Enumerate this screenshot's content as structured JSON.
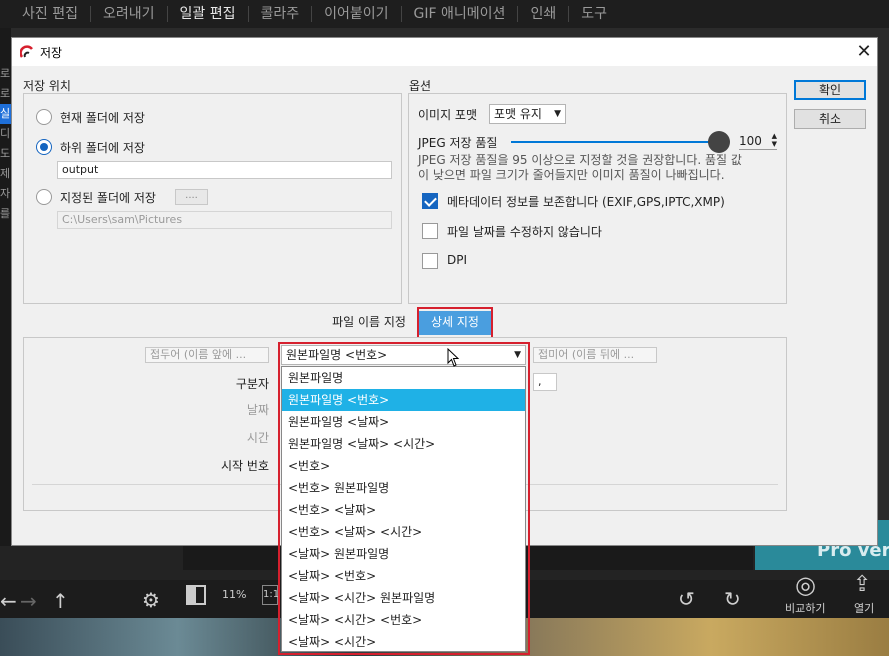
{
  "app": {
    "nav": [
      "사진 편집",
      "오려내기",
      "일괄 편집",
      "콜라주",
      "이어붙이기",
      "GIF 애니메이션",
      "인쇄",
      "도구"
    ],
    "active_nav": "일괄 편집",
    "left_items": [
      "로",
      "로",
      "실",
      "디",
      "도",
      "제",
      "자",
      "를"
    ],
    "pro_banner": "Pro vers",
    "zoom": "11%",
    "zoom_ratio": "1:1",
    "compare_label": "비교하기",
    "open_label": "열기"
  },
  "dialog": {
    "title": "저장",
    "close": "✕",
    "location": {
      "label": "저장 위치",
      "current_folder": "현재 폴더에 저장",
      "sub_folder": "하위 폴더에 저장",
      "sub_folder_value": "output",
      "specified_folder": "지정된 폴더에 저장",
      "browse": "....",
      "path_value": "C:\\Users\\sam\\Pictures",
      "selected": "sub_folder"
    },
    "options": {
      "label": "옵션",
      "format_label": "이미지 포맷",
      "format_value": "포맷 유지",
      "jpeg_label": "JPEG 저장 품질",
      "jpeg_value": "100",
      "jpeg_quality": 100,
      "jpeg_note_1": "JPEG 저장 품질을 95 이상으로 지정할 것을 권장합니다. 품질 값",
      "jpeg_note_2": "이 낮으면 파일 크기가 줄어들지만 이미지 품질이 나빠집니다.",
      "metadata_label": "메타데이터 정보를 보존합니다 (EXIF,GPS,IPTC,XMP)",
      "metadata_checked": true,
      "filedate_label": "파일 날짜를 수정하지 않습니다",
      "filedate_checked": false,
      "dpi_label": "DPI",
      "dpi_checked": false
    },
    "buttons": {
      "ok": "확인",
      "cancel": "취소"
    },
    "tabs": {
      "filename": "파일 이름 지정",
      "advanced": "상세 지정"
    },
    "naming": {
      "prefix_placeholder": "접두어 (이름 앞에 ...",
      "pattern_value": "원본파일명 <번호>",
      "suffix_placeholder": "접미어 (이름 뒤에 ...",
      "separator_label": "구분자",
      "separator_value": ",",
      "date_label": "날짜",
      "time_label": "시간",
      "start_number_label": "시작 번호"
    },
    "dropdown_options": [
      "원본파일명",
      "원본파일명 <번호>",
      "원본파일명 <날짜>",
      "원본파일명 <날짜> <시간>",
      "<번호>",
      "<번호> 원본파일명",
      "<번호> <날짜>",
      "<번호> <날짜> <시간>",
      "<날짜> 원본파일명",
      "<날짜> <번호>",
      "<날짜> <시간> 원본파일명",
      "<날짜> <시간> <번호>",
      "<날짜> <시간>"
    ],
    "dropdown_highlighted": 1
  }
}
